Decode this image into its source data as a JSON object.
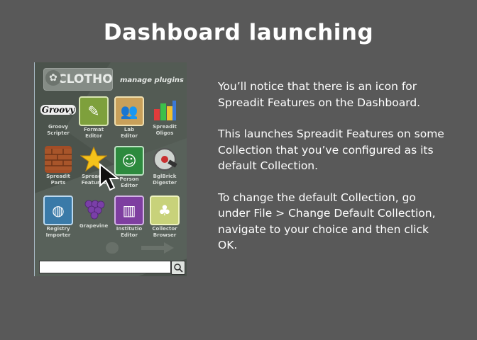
{
  "slide": {
    "title": "Dashboard launching"
  },
  "dashboard": {
    "logo_text": "CLOTHO",
    "manage_plugins": "manage plugins",
    "tiles": [
      {
        "label_lines": [
          "Groovy",
          "Scripter"
        ],
        "icon": "groovy-logo-icon",
        "icon_text": "Groovy"
      },
      {
        "label_lines": [
          "Format",
          "Editor"
        ],
        "icon": "format-editor-icon",
        "icon_text": "✎"
      },
      {
        "label_lines": [
          "Lab",
          "Editor"
        ],
        "icon": "lab-people-icon",
        "icon_text": "👥"
      },
      {
        "label_lines": [
          "Spreadit",
          "Oligos"
        ],
        "icon": "oligos-blocks-icon",
        "icon_text": "▙"
      },
      {
        "label_lines": [
          "Spreadit",
          "Parts"
        ],
        "icon": "brick-icon",
        "icon_text": "▦"
      },
      {
        "label_lines": [
          "Spreadit",
          "Features"
        ],
        "icon": "star-icon",
        "icon_text": "★"
      },
      {
        "label_lines": [
          "Person",
          "Editor"
        ],
        "icon": "person-icon",
        "icon_text": "☺"
      },
      {
        "label_lines": [
          "BglBrick",
          "Digester"
        ],
        "icon": "saw-blade-icon",
        "icon_text": "⚙"
      },
      {
        "label_lines": [
          "Registry",
          "Importer"
        ],
        "icon": "registry-globe-icon",
        "icon_text": "◍"
      },
      {
        "label_lines": [
          "Grapevine",
          ""
        ],
        "icon": "grapes-icon",
        "icon_text": "❀"
      },
      {
        "label_lines": [
          "Institutio",
          "Editor"
        ],
        "icon": "building-icon",
        "icon_text": "▥"
      },
      {
        "label_lines": [
          "Collector",
          "Browser"
        ],
        "icon": "collector-icon",
        "icon_text": "♣"
      }
    ],
    "search_placeholder": "",
    "search_button_icon": "magnifier-icon"
  },
  "bullets": [
    "You’ll notice that there is an icon for Spreadit Features on the Dashboard.",
    "This launches Spreadit Features on some Collection that you’ve configured as its default Collection.",
    "To change the default Collection, go under File > Change Default Collection, navigate to your choice and then click OK."
  ]
}
